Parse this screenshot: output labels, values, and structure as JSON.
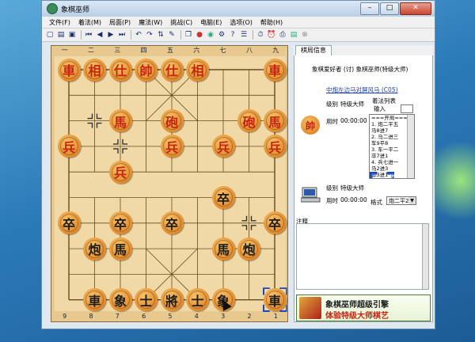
{
  "window": {
    "title": "象棋巫师"
  },
  "menu": [
    "文件(F)",
    "着法(M)",
    "局面(P)",
    "魔法(W)",
    "挑战(C)",
    "电脑(E)",
    "选项(O)",
    "帮助(H)"
  ],
  "board": {
    "files_top": [
      "一",
      "二",
      "三",
      "四",
      "五",
      "六",
      "七",
      "八",
      "九"
    ],
    "files_bottom": [
      "9",
      "8",
      "7",
      "6",
      "5",
      "4",
      "3",
      "2",
      "1"
    ],
    "pieces": [
      {
        "t": "車",
        "side": "red",
        "c": 0,
        "r": 0
      },
      {
        "t": "相",
        "side": "red",
        "c": 1,
        "r": 0
      },
      {
        "t": "仕",
        "side": "red",
        "c": 2,
        "r": 0
      },
      {
        "t": "帥",
        "side": "red",
        "c": 3,
        "r": 0
      },
      {
        "t": "仕",
        "side": "red",
        "c": 4,
        "r": 0
      },
      {
        "t": "相",
        "side": "red",
        "c": 5,
        "r": 0
      },
      {
        "t": "車",
        "side": "red",
        "c": 8,
        "r": 0
      },
      {
        "t": "馬",
        "side": "red",
        "c": 2,
        "r": 2
      },
      {
        "t": "砲",
        "side": "red",
        "c": 4,
        "r": 2
      },
      {
        "t": "砲",
        "side": "red",
        "c": 7,
        "r": 2
      },
      {
        "t": "馬",
        "side": "red",
        "c": 8,
        "r": 2
      },
      {
        "t": "兵",
        "side": "red",
        "c": 0,
        "r": 3
      },
      {
        "t": "兵",
        "side": "red",
        "c": 4,
        "r": 3
      },
      {
        "t": "兵",
        "side": "red",
        "c": 6,
        "r": 3
      },
      {
        "t": "兵",
        "side": "red",
        "c": 8,
        "r": 3
      },
      {
        "t": "兵",
        "side": "red",
        "c": 2,
        "r": 4
      },
      {
        "t": "卒",
        "side": "black",
        "c": 6,
        "r": 5
      },
      {
        "t": "卒",
        "side": "black",
        "c": 0,
        "r": 6
      },
      {
        "t": "卒",
        "side": "black",
        "c": 2,
        "r": 6
      },
      {
        "t": "卒",
        "side": "black",
        "c": 4,
        "r": 6
      },
      {
        "t": "卒",
        "side": "black",
        "c": 8,
        "r": 6
      },
      {
        "t": "炮",
        "side": "black",
        "c": 1,
        "r": 7
      },
      {
        "t": "馬",
        "side": "black",
        "c": 2,
        "r": 7
      },
      {
        "t": "馬",
        "side": "black",
        "c": 6,
        "r": 7
      },
      {
        "t": "炮",
        "side": "black",
        "c": 7,
        "r": 7
      },
      {
        "t": "車",
        "side": "black",
        "c": 1,
        "r": 9
      },
      {
        "t": "象",
        "side": "black",
        "c": 2,
        "r": 9
      },
      {
        "t": "士",
        "side": "black",
        "c": 3,
        "r": 9
      },
      {
        "t": "將",
        "side": "black",
        "c": 4,
        "r": 9
      },
      {
        "t": "士",
        "side": "black",
        "c": 5,
        "r": 9
      },
      {
        "t": "象",
        "side": "black",
        "c": 6,
        "r": 9
      },
      {
        "t": "車",
        "side": "black",
        "c": 8,
        "r": 9
      }
    ],
    "markers": [
      {
        "c": 1,
        "r": 2
      },
      {
        "c": 2,
        "r": 3
      },
      {
        "c": 7,
        "r": 6
      }
    ]
  },
  "panel": {
    "tab": "棋局信息",
    "players_line": "象棋爱好者 (讨) 象棋巫师(特级大师)",
    "opening_link": "中炮左边马对屏风马 (C05)",
    "red_level_label": "级别",
    "red_level": "特级大师",
    "red_time_label": "用时",
    "red_time": "00:00:00",
    "movelist_title": "着法列表",
    "input_label": "输入",
    "moves": [
      "===开局===",
      "1. 炮二平五",
      "  马8进7",
      "2. 马二进三",
      "  车9平8",
      "3. 车一平二",
      "  卒7进1",
      "4. 兵七进一",
      "  马2进3",
      "5. 马八进七",
      "  卒3进1"
    ],
    "selected_move": 9,
    "black_level_label": "级别",
    "black_level": "特级大师",
    "black_time_label": "用时",
    "black_time": "00:00:00",
    "format_label": "格式",
    "format_value": "炮二平2",
    "note_label": "注释",
    "banner_line1": "象棋巫师超级引擎",
    "banner_line2": "体验特级大师棋艺"
  }
}
